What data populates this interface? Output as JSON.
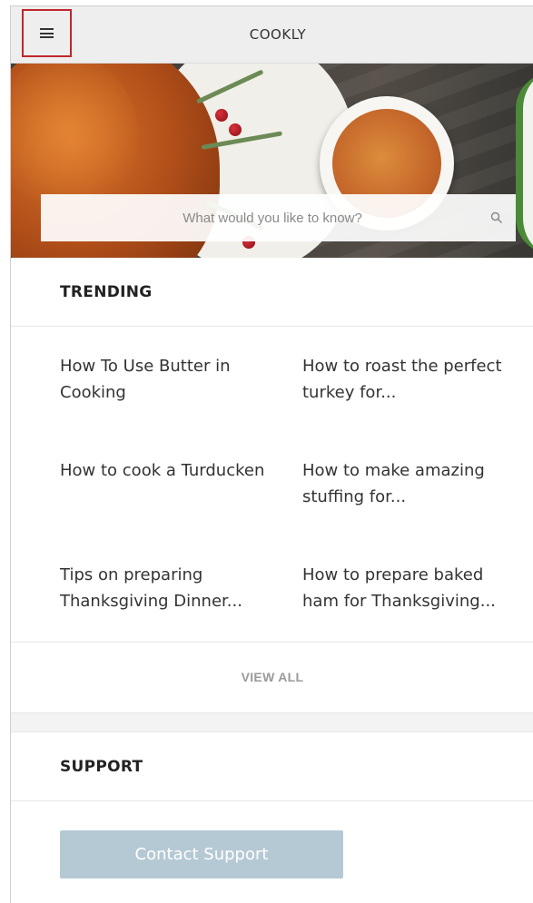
{
  "header": {
    "app_title": "COOKLY",
    "menu_icon": "hamburger-menu-icon"
  },
  "hero": {
    "search_placeholder": "What would you like to know?",
    "search_icon": "search-icon"
  },
  "trending": {
    "title": "TRENDING",
    "items": [
      {
        "label": "How To Use Butter in Cooking"
      },
      {
        "label": "How to roast the perfect turkey for..."
      },
      {
        "label": "How to cook a Turducken"
      },
      {
        "label": "How to make amazing stuffing for..."
      },
      {
        "label": "Tips on preparing Thanksgiving Dinner..."
      },
      {
        "label": "How to prepare baked ham for Thanksgiving..."
      }
    ],
    "view_all_label": "VIEW ALL"
  },
  "support": {
    "title": "SUPPORT",
    "contact_label": "Contact Support"
  },
  "colors": {
    "header_bg": "#eeeeee",
    "highlight_border": "#c0262b",
    "contact_button_bg": "#b5c9d5",
    "muted_text": "#9a9a9a"
  }
}
